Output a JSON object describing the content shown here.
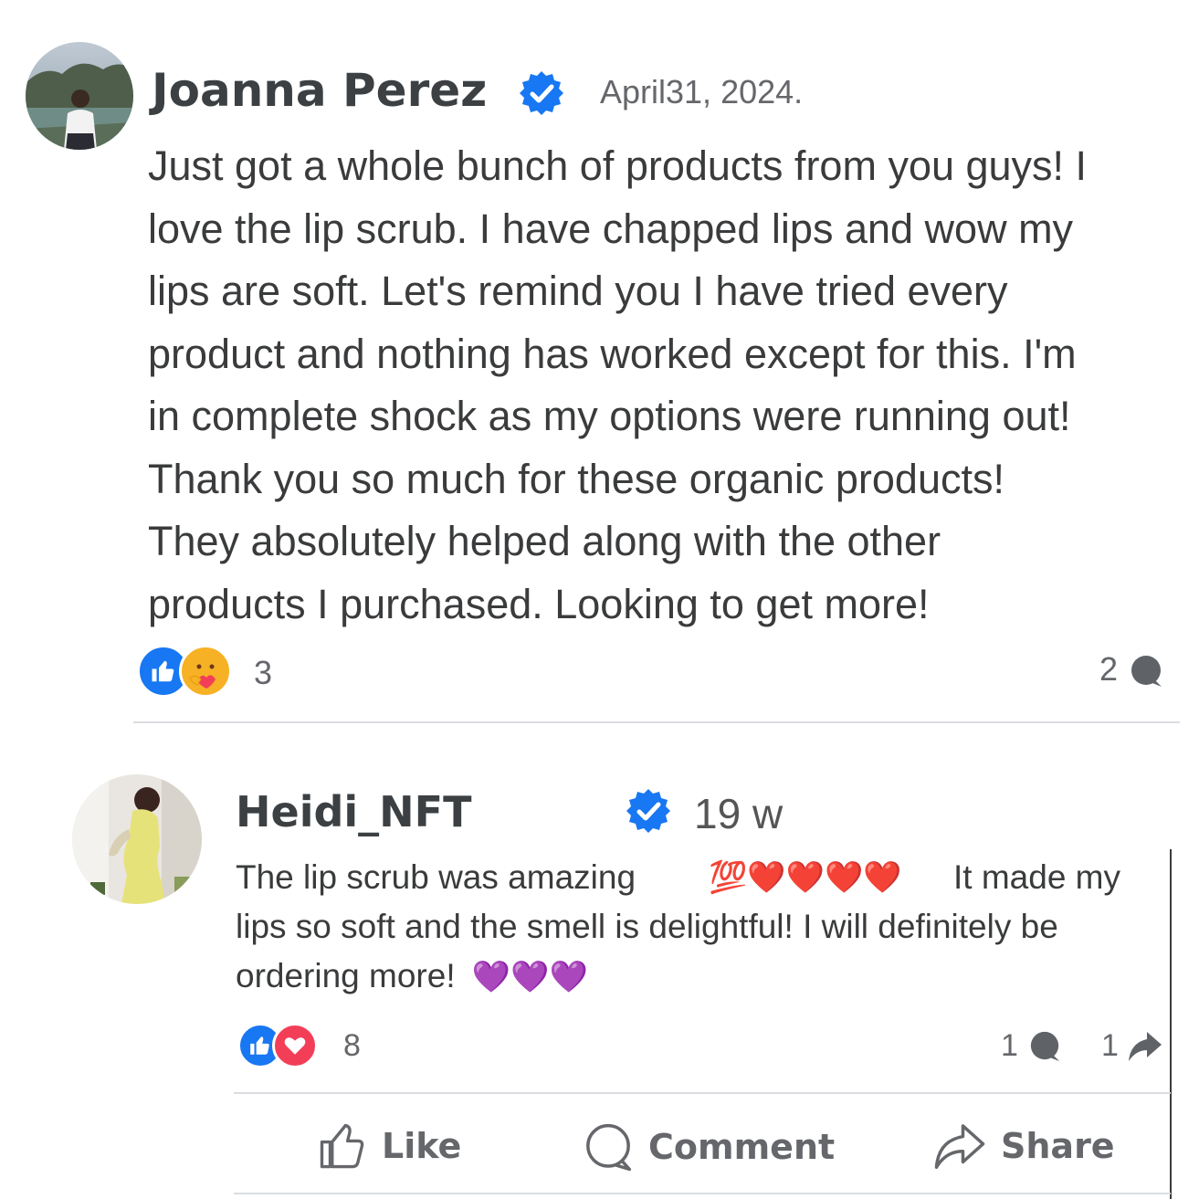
{
  "post": {
    "author": "Joanna Perez",
    "date": "April31, 2024.",
    "lines": [
      "Just got a whole bunch of products from you guys! I",
      "love the lip scrub. I have chapped lips and wow my",
      "lips are soft. Let's remind you I have tried every",
      "product and nothing has worked except for this. I'm",
      "in complete shock as my options were running out!",
      "Thank you so much for these organic products!",
      "They absolutely helped along with the other",
      "products I purchased. Looking to get more!"
    ],
    "reaction_count": "3",
    "comment_count": "2",
    "reaction_icons": [
      "like-icon",
      "care-icon"
    ]
  },
  "reply": {
    "author": "Heidi_NFT",
    "time": "19 w",
    "line1_start": "The lip scrub was amazing",
    "line1_emoji": "💯❤️❤️❤️❤️",
    "line1_end": "It made my",
    "line2": "lips so soft and the smell is delightful! I will definitely be",
    "line3_start": "ordering more!",
    "line3_emoji": "💜💜💜",
    "reaction_count": "8",
    "comment_count": "1",
    "share_count": "1",
    "reaction_icons": [
      "like-icon",
      "love-icon"
    ]
  },
  "actions": {
    "like": "Like",
    "comment": "Comment",
    "share": "Share"
  },
  "colors": {
    "verified": "#1877f2",
    "like": "#1877f2",
    "love": "#f33e58",
    "care": "#f7b125",
    "purple_heart": "#8b3ff2",
    "red_heart": "#e0242c"
  }
}
